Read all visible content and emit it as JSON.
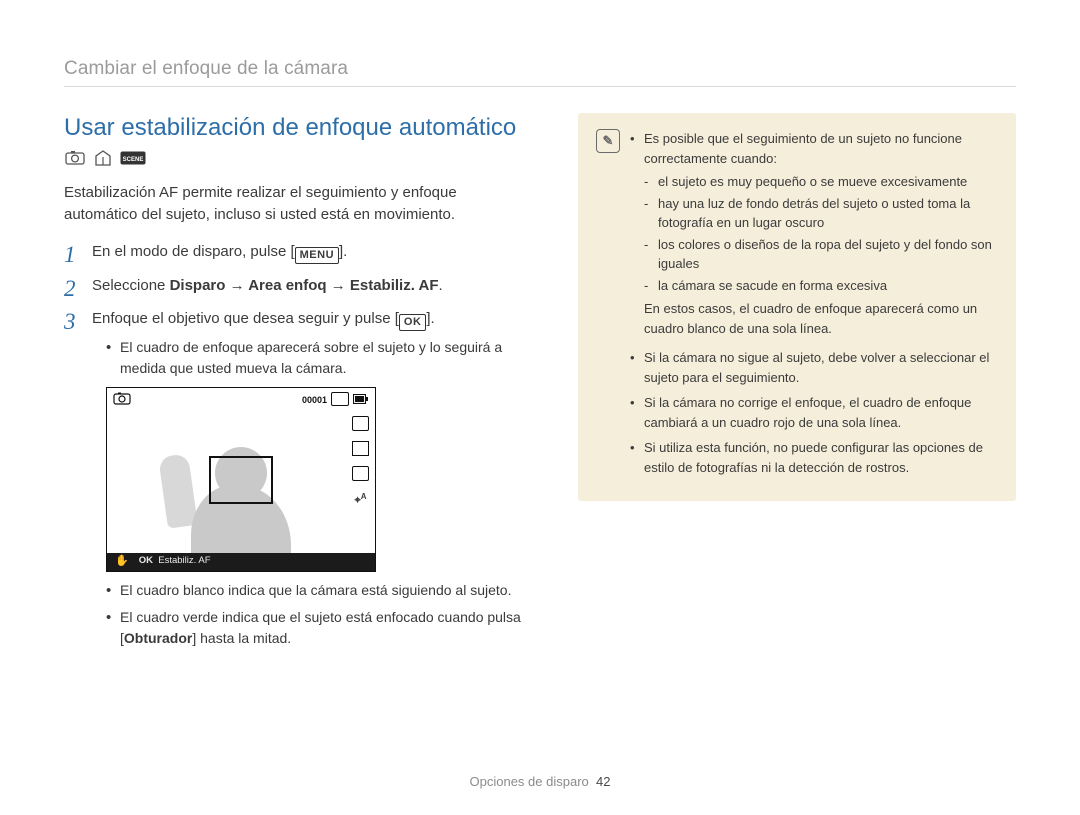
{
  "breadcrumb": "Cambiar el enfoque de la cámara",
  "section_title": "Usar estabilización de enfoque automático",
  "intro": "Estabilización AF permite realizar el seguimiento y enfoque automático del sujeto, incluso si usted está en movimiento.",
  "buttons": {
    "menu": "MENU",
    "ok": "OK",
    "shutter": "Obturador"
  },
  "steps": {
    "s1_pre": "En el modo de disparo, pulse [",
    "s1_post": "].",
    "s2_pre": "Seleccione ",
    "s2_bold": "Disparo → Area enfoq → Estabiliz. AF",
    "s2_post": ".",
    "s3_pre": "Enfoque el objetivo que desea seguir y pulse [",
    "s3_post": "].",
    "s3_bullet1": "El cuadro de enfoque aparecerá sobre el sujeto y lo seguirá a medida que usted mueva la cámara.",
    "s3_bullet2": "El cuadro blanco indica que la cámara está siguiendo al sujeto.",
    "s3_bullet3_pre": "El cuadro verde indica que el sujeto está enfocado cuando pulsa [",
    "s3_bullet3_post": "] hasta la mitad."
  },
  "preview": {
    "counter": "00001",
    "ok_label": "OK",
    "mode_label": "Estabiliz. AF"
  },
  "notes": {
    "n1_lead": "Es posible que el seguimiento de un sujeto no funcione correctamente cuando:",
    "n1_d1": "el sujeto es muy pequeño o se mueve excesivamente",
    "n1_d2": "hay una luz de fondo detrás del sujeto o usted toma la fotografía en un lugar oscuro",
    "n1_d3": "los colores o diseños de la ropa del sujeto y del fondo son iguales",
    "n1_d4": "la cámara se sacude en forma excesiva",
    "n1_tail": "En estos casos, el cuadro de enfoque aparecerá como un cuadro blanco de una sola línea.",
    "n2": "Si la cámara no sigue al sujeto, debe volver a seleccionar el sujeto para el seguimiento.",
    "n3": "Si la cámara no corrige el enfoque, el cuadro de enfoque cambiará a un cuadro rojo de una sola línea.",
    "n4": "Si utiliza esta función, no puede configurar las opciones de estilo de fotografías ni la detección de rostros."
  },
  "footer": {
    "section": "Opciones de disparo",
    "page": "42"
  },
  "note_icon_glyph": "✎"
}
